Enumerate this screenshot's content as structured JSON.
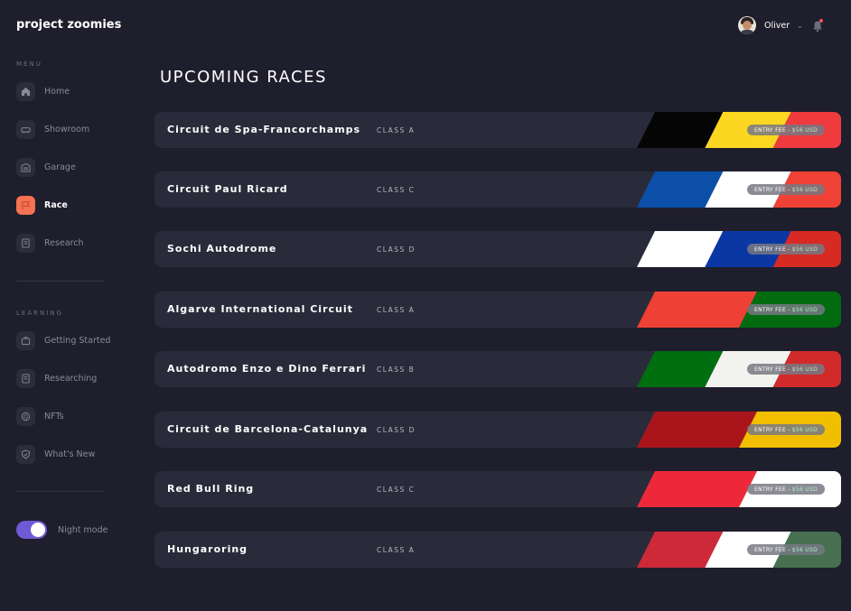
{
  "app": {
    "logo": "project zoomies"
  },
  "sidebar": {
    "menu_label": "MENU",
    "menu_items": [
      {
        "label": "Home",
        "icon": "home-icon",
        "active": false
      },
      {
        "label": "Showroom",
        "icon": "car-icon",
        "active": false
      },
      {
        "label": "Garage",
        "icon": "garage-icon",
        "active": false
      },
      {
        "label": "Race",
        "icon": "flag-icon",
        "active": true
      },
      {
        "label": "Research",
        "icon": "document-icon",
        "active": false
      }
    ],
    "learning_label": "LEARNING",
    "learning_items": [
      {
        "label": "Getting Started",
        "icon": "briefcase-icon"
      },
      {
        "label": "Researching",
        "icon": "document-icon"
      },
      {
        "label": "NFTs",
        "icon": "coin-icon"
      },
      {
        "label": "What's New",
        "icon": "shield-icon"
      }
    ],
    "night_mode": {
      "label": "Night mode",
      "on": true
    }
  },
  "header": {
    "user_name": "Oliver",
    "notifications": true
  },
  "main": {
    "title": "UPCOMING RACES",
    "fee_label": "ENTRY FEE -",
    "fee_amount": "$56 USD",
    "races": [
      {
        "name": "Circuit de Spa-Francorchamps",
        "class": "CLASS A",
        "flag": [
          "#050505",
          "#fcd721",
          "#ef3b3e"
        ]
      },
      {
        "name": "Circuit Paul Ricard",
        "class": "CLASS C",
        "flag": [
          "#0b4fa8",
          "#ffffff",
          "#ef4135"
        ]
      },
      {
        "name": "Sochi Autodrome",
        "class": "CLASS D",
        "flag": [
          "#ffffff",
          "#0b37a5",
          "#d62a23"
        ]
      },
      {
        "name": "Algarve International Circuit",
        "class": "CLASS A",
        "flag": [
          "#ef4035",
          "#006c0f"
        ]
      },
      {
        "name": "Autodromo Enzo e Dino Ferrari",
        "class": "CLASS B",
        "flag": [
          "#006f0f",
          "#f2f2ee",
          "#d22a2b"
        ]
      },
      {
        "name": "Circuit de Barcelona-Catalunya",
        "class": "CLASS D",
        "flag": [
          "#aa151b",
          "#f1bf00"
        ]
      },
      {
        "name": "Red Bull Ring",
        "class": "CLASS C",
        "flag": [
          "#ed2939",
          "#ffffff"
        ]
      },
      {
        "name": "Hungaroring",
        "class": "CLASS A",
        "flag": [
          "#ce2939",
          "#ffffff",
          "#477050"
        ]
      }
    ]
  }
}
